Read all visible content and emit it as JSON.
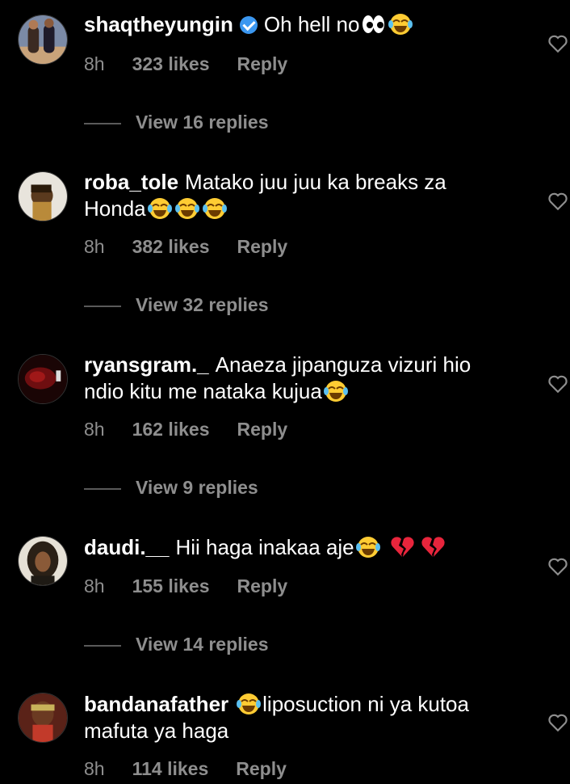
{
  "comments": [
    {
      "user": "shaqtheyungin",
      "verified": true,
      "text_before": "Oh hell no",
      "emojis_before": [
        "eyes-emoji",
        "joy-emoji"
      ],
      "text": "",
      "emojis_after": [],
      "time": "8h",
      "likes": "323 likes",
      "reply": "Reply",
      "replies": "View 16 replies"
    },
    {
      "user": "roba_tole",
      "verified": false,
      "text_before": "Matako juu juu ka breaks za Honda",
      "emojis_before": [
        "joy-emoji",
        "joy-emoji",
        "joy-emoji"
      ],
      "text": "",
      "emojis_after": [],
      "time": "8h",
      "likes": "382 likes",
      "reply": "Reply",
      "replies": "View 32 replies"
    },
    {
      "user": "ryansgram._",
      "verified": false,
      "text_before": "Anaeza jipanguza vizuri hio ndio kitu me nataka kujua",
      "emojis_before": [
        "joy-emoji"
      ],
      "text": "",
      "emojis_after": [],
      "time": "8h",
      "likes": "162 likes",
      "reply": "Reply",
      "replies": "View 9 replies"
    },
    {
      "user": "daudi.__",
      "verified": false,
      "text_before": "Hii haga inakaa aje",
      "emojis_before": [
        "joy-emoji",
        "broken-heart-emoji",
        "broken-heart-emoji"
      ],
      "text": "",
      "emojis_after": [],
      "time": "8h",
      "likes": "155 likes",
      "reply": "Reply",
      "replies": "View 14 replies"
    },
    {
      "user": "bandanafather",
      "verified": false,
      "text_before": "",
      "emojis_before": [
        "joy-emoji"
      ],
      "text": "liposuction ni ya kutoa mafuta ya haga",
      "emojis_after": [],
      "time": "8h",
      "likes": "114 likes",
      "reply": "Reply",
      "replies": ""
    }
  ],
  "colors": {
    "background": "#000000",
    "muted": "#8e8e8e",
    "verified": "#3b97f0",
    "broken_heart": "#e8253c",
    "joy": "#ffcc33"
  }
}
